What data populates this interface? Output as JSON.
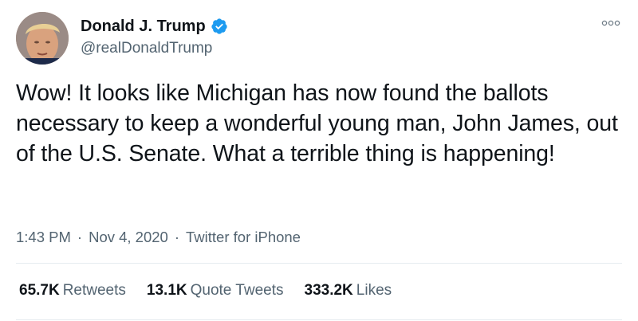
{
  "author": {
    "display_name": "Donald J. Trump",
    "handle": "@realDonaldTrump",
    "verified": true,
    "verified_color": "#1d9bf0"
  },
  "tweet": {
    "text": "Wow! It looks like Michigan has now found the ballots necessary to keep a wonderful young man, John James, out of the U.S. Senate. What a terrible thing is happening!",
    "time": "1:43 PM",
    "date": "Nov 4, 2020",
    "source": "Twitter for iPhone",
    "separator": "·"
  },
  "stats": {
    "retweets_count": "65.7K",
    "retweets_label": "Retweets",
    "quotes_count": "13.1K",
    "quotes_label": "Quote Tweets",
    "likes_count": "333.2K",
    "likes_label": "Likes"
  },
  "icons": {
    "more": "more-options-icon",
    "verified": "verified-badge-icon"
  }
}
